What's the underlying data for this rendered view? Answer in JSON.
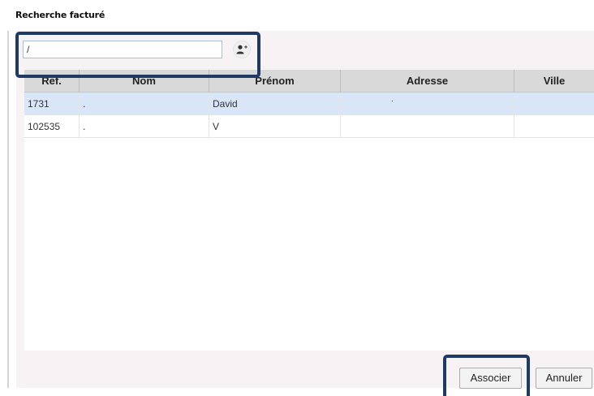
{
  "dialog": {
    "title": "Recherche facturé"
  },
  "search": {
    "value": "/",
    "placeholder": ""
  },
  "add_person": {
    "icon": "add-person-icon"
  },
  "table": {
    "columns": [
      "Ref.",
      "Nom",
      "Prénom",
      "Adresse",
      "Ville"
    ],
    "rows": [
      {
        "ref": "1731",
        "nom": ".",
        "prenom": "David",
        "adresse": ".",
        "ville": ""
      },
      {
        "ref": "102535",
        "nom": ".",
        "prenom": "V",
        "adresse": "",
        "ville": ""
      }
    ],
    "selected_row": 0
  },
  "footer": {
    "associate_label": "Associer",
    "cancel_label": "Annuler"
  },
  "colors": {
    "annotation": "#1f3a64",
    "selected_row": "#d8e6f7",
    "header_bg": "#d9d9d9",
    "panel_bg": "#f7f3f5"
  }
}
